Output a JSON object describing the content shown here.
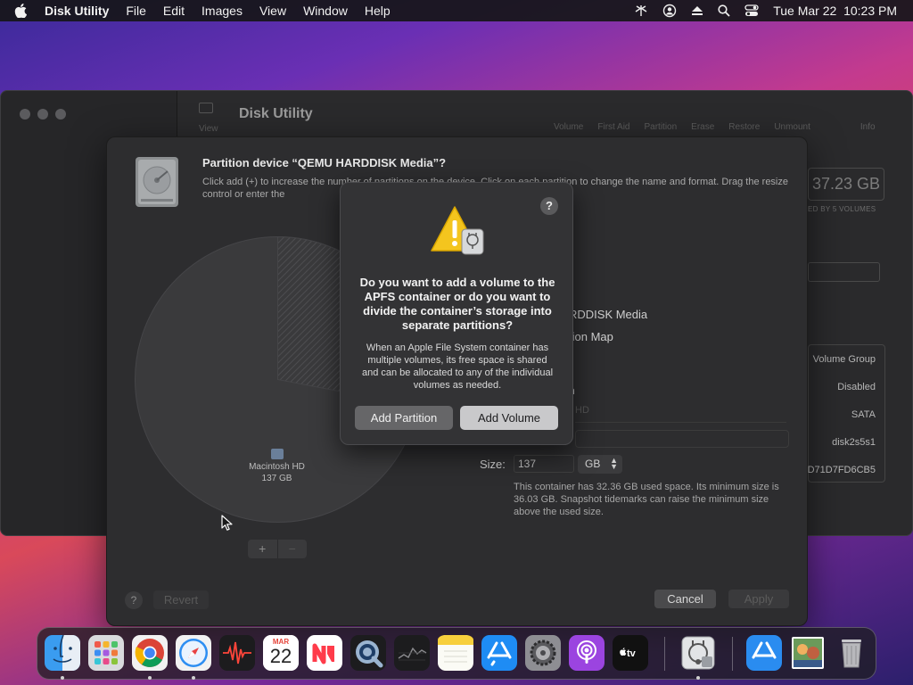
{
  "menubar": {
    "app_name": "Disk Utility",
    "menus": [
      "File",
      "Edit",
      "Images",
      "View",
      "Window",
      "Help"
    ],
    "datetime": "Tue Mar 22  10:23 PM"
  },
  "main_window": {
    "title": "Disk Utility",
    "view_label": "View",
    "toolbar": [
      "Volume",
      "First Aid",
      "Partition",
      "Erase",
      "Restore",
      "Unmount",
      "Info"
    ],
    "capacity": "37.23 GB",
    "shared_by": "ED BY 5 VOLUMES",
    "info_rows": [
      "Volume Group",
      "Disabled",
      "SATA",
      "disk2s5s1",
      "D71D7FD6CB5"
    ]
  },
  "sheet": {
    "title": "Partition device “QEMU HARDDISK Media”?",
    "description": "Click add (+) to increase the number of partitions on the device. Click on each partition to change the name and format. Drag the resize control or enter the",
    "pie": {
      "volume_name": "Macintosh HD",
      "volume_size": "137 GB",
      "used_fraction": 0.28
    },
    "details": {
      "name_partial": "RDDISK Media",
      "scheme_partial": "tion Map",
      "section_partial": "n",
      "name_field_partial": "HD"
    },
    "size_label": "Size:",
    "size_value": "137",
    "unit": "GB",
    "container_note": "This container has 32.36 GB used space. Its minimum size is 36.03 GB. Snapshot tidemarks can raise the minimum size above the used size.",
    "add_symbol": "+",
    "remove_symbol": "−",
    "help_symbol": "?",
    "revert_label": "Revert",
    "cancel_label": "Cancel",
    "apply_label": "Apply"
  },
  "alert": {
    "help_symbol": "?",
    "heading": "Do you want to add a volume to the APFS container or do you want to divide the container’s storage into separate partitions?",
    "body": "When an Apple File System container has multiple volumes, its free space is shared and can be allocated to any of the individual volumes as needed.",
    "add_partition_label": "Add Partition",
    "add_volume_label": "Add Volume"
  },
  "dock": {
    "calendar_month": "MAR",
    "calendar_day": "22",
    "apps": [
      "finder",
      "launchpad",
      "chrome",
      "safari",
      "voice-memos",
      "calendar",
      "news",
      "quicktime",
      "stocks",
      "notes",
      "app-store",
      "system-preferences",
      "podcasts",
      "apple-tv",
      "disk-utility",
      "app-store-folder",
      "preview-image",
      "trash"
    ]
  }
}
